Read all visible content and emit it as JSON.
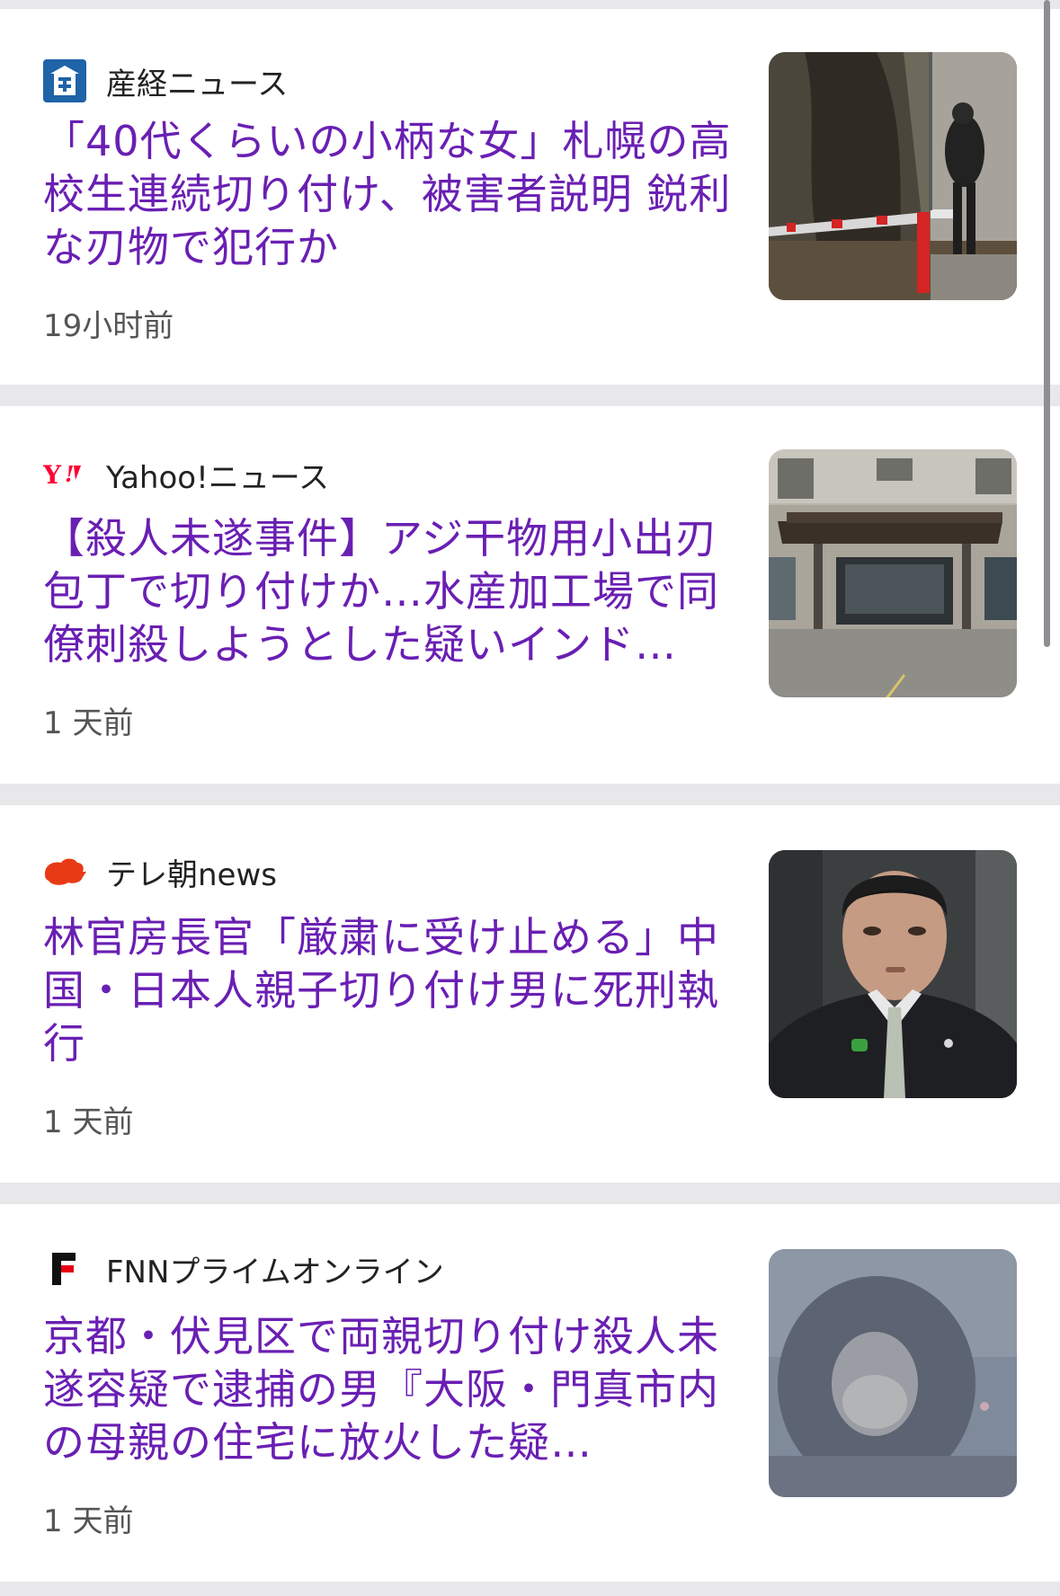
{
  "feed": {
    "items": [
      {
        "source": "産経ニュース",
        "source_icon": "sankei-logo-icon",
        "headline": "「40代くらいの小柄な女」札幌の高校生連続切り付け、被害者説明 鋭利な刃物で犯行か",
        "time": "19小时前",
        "thumbnail": "street-scene-thumbnail"
      },
      {
        "source": "Yahoo!ニュース",
        "source_icon": "yahoo-logo-icon",
        "headline": "【殺人未遂事件】アジ干物用小出刃包丁で切り付けか…水産加工場で同僚刺殺しようとした疑いインド…",
        "time": "1 天前",
        "thumbnail": "building-entrance-thumbnail"
      },
      {
        "source": "テレ朝news",
        "source_icon": "tvasahi-logo-icon",
        "headline": "林官房長官「厳粛に受け止める」中国・日本人親子切り付け男に死刑執行",
        "time": "1 天前",
        "thumbnail": "official-portrait-thumbnail"
      },
      {
        "source": "FNNプライムオンライン",
        "source_icon": "fnn-logo-icon",
        "headline": "京都・伏見区で両親切り付け殺人未遂容疑で逮捕の男『大阪・門真市内の母親の住宅に放火した疑…",
        "time": "1 天前",
        "thumbnail": "blurred-person-thumbnail"
      }
    ]
  },
  "colors": {
    "headline": "#6a1fb3",
    "source_text": "#222222",
    "time_text": "#555555",
    "separator": "#e8e8ea",
    "card_bg": "#ffffff",
    "sankei_blue": "#1f63a8",
    "yahoo_red": "#ff0033",
    "tvasahi_red": "#e83a15"
  }
}
